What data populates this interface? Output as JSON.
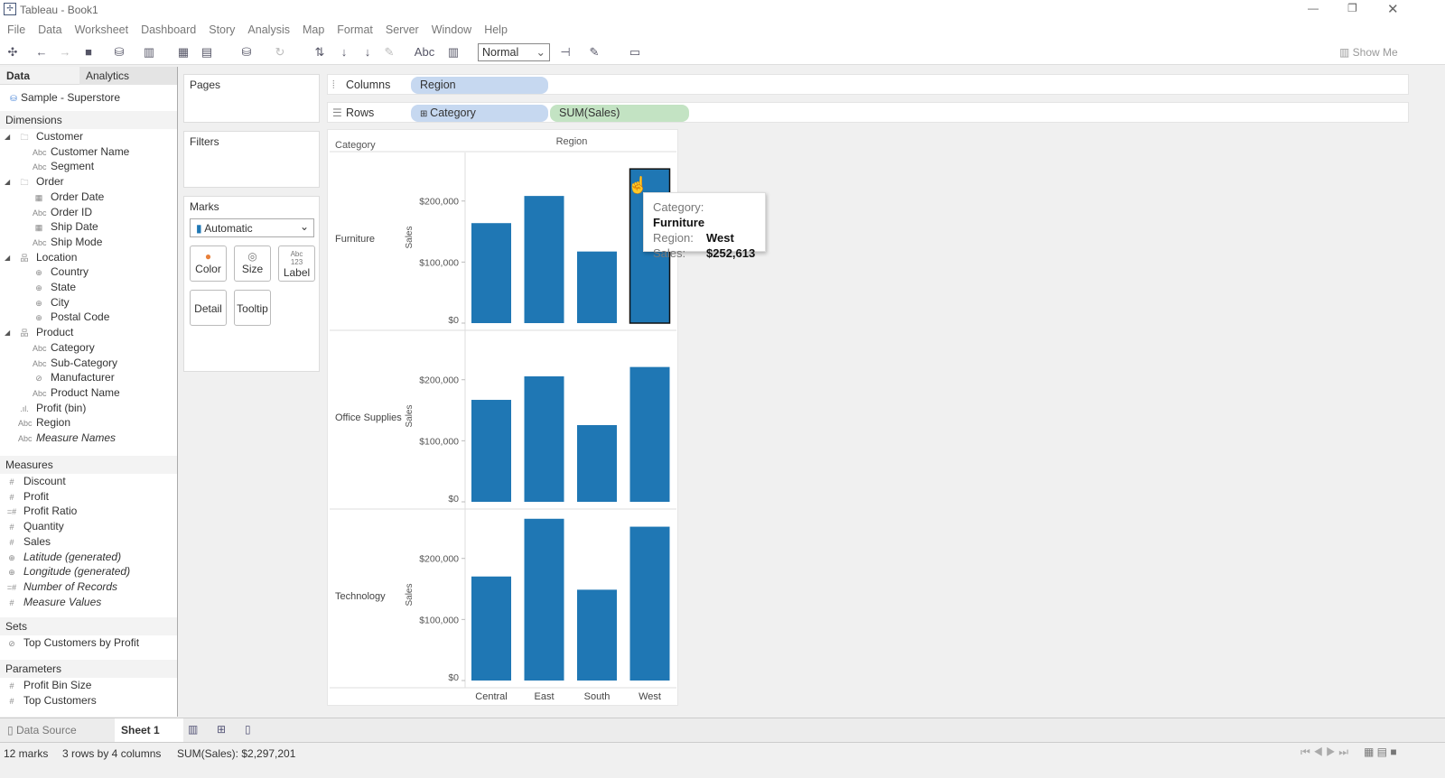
{
  "window": {
    "title": "Tableau - Book1"
  },
  "menu": [
    "File",
    "Data",
    "Worksheet",
    "Dashboard",
    "Story",
    "Analysis",
    "Map",
    "Format",
    "Server",
    "Window",
    "Help"
  ],
  "toolbar": {
    "fit": "Normal",
    "show_me": "Show Me"
  },
  "left": {
    "tab_data": "Data",
    "tab_analytics": "Analytics",
    "datasource": "Sample - Superstore",
    "dimensions_label": "Dimensions",
    "dimensions": [
      {
        "label": "Customer",
        "icon": "folder",
        "level": 0
      },
      {
        "label": "Customer Name",
        "icon": "Abc",
        "level": 1
      },
      {
        "label": "Segment",
        "icon": "Abc",
        "level": 1
      },
      {
        "label": "Order",
        "icon": "folder",
        "level": 0
      },
      {
        "label": "Order Date",
        "icon": "date",
        "level": 1
      },
      {
        "label": "Order ID",
        "icon": "Abc",
        "level": 1
      },
      {
        "label": "Ship Date",
        "icon": "date",
        "level": 1
      },
      {
        "label": "Ship Mode",
        "icon": "Abc",
        "level": 1
      },
      {
        "label": "Location",
        "icon": "hierarchy",
        "level": 0
      },
      {
        "label": "Country",
        "icon": "globe",
        "level": 1
      },
      {
        "label": "State",
        "icon": "globe",
        "level": 1
      },
      {
        "label": "City",
        "icon": "globe",
        "level": 1
      },
      {
        "label": "Postal Code",
        "icon": "globe",
        "level": 1
      },
      {
        "label": "Product",
        "icon": "hierarchy",
        "level": 0
      },
      {
        "label": "Category",
        "icon": "Abc",
        "level": 1
      },
      {
        "label": "Sub-Category",
        "icon": "Abc",
        "level": 1
      },
      {
        "label": "Manufacturer",
        "icon": "link",
        "level": 1
      },
      {
        "label": "Product Name",
        "icon": "Abc",
        "level": 1
      },
      {
        "label": "Profit (bin)",
        "icon": "bin",
        "level": 0
      },
      {
        "label": "Region",
        "icon": "Abc",
        "level": 0
      },
      {
        "label": "Measure Names",
        "icon": "Abc",
        "level": 0,
        "italic": true
      }
    ],
    "measures_label": "Measures",
    "measures": [
      {
        "label": "Discount",
        "icon": "#"
      },
      {
        "label": "Profit",
        "icon": "#"
      },
      {
        "label": "Profit Ratio",
        "icon": "=#"
      },
      {
        "label": "Quantity",
        "icon": "#"
      },
      {
        "label": "Sales",
        "icon": "#"
      },
      {
        "label": "Latitude (generated)",
        "icon": "globe",
        "italic": true
      },
      {
        "label": "Longitude (generated)",
        "icon": "globe",
        "italic": true
      },
      {
        "label": "Number of Records",
        "icon": "=#",
        "italic": true
      },
      {
        "label": "Measure Values",
        "icon": "#",
        "italic": true
      }
    ],
    "sets_label": "Sets",
    "sets": [
      {
        "label": "Top Customers by Profit"
      }
    ],
    "params_label": "Parameters",
    "params": [
      {
        "label": "Profit Bin Size"
      },
      {
        "label": "Top Customers"
      }
    ]
  },
  "cards": {
    "pages": "Pages",
    "filters": "Filters",
    "marks": "Marks",
    "mark_type": "Automatic",
    "buttons": [
      "Color",
      "Size",
      "Label",
      "Detail",
      "Tooltip"
    ]
  },
  "shelves": {
    "columns": "Columns",
    "rows": "Rows",
    "col_pill": "Region",
    "row_pill1": "Category",
    "row_pill2": "SUM(Sales)"
  },
  "chart_data": {
    "type": "bar",
    "title": "",
    "row_header": "Category",
    "col_header": "Region",
    "ylabel": "Sales",
    "categories": [
      "Central",
      "East",
      "South",
      "West"
    ],
    "yticks": [
      "$0",
      "$100,000",
      "$200,000"
    ],
    "ylim": [
      0,
      275000
    ],
    "series": [
      {
        "name": "Furniture",
        "values": [
          163797,
          208291,
          117299,
          252613
        ]
      },
      {
        "name": "Office Supplies",
        "values": [
          167026,
          205516,
          125651,
          220853
        ]
      },
      {
        "name": "Technology",
        "values": [
          170416,
          264974,
          148772,
          251992
        ]
      }
    ],
    "color": "#1f77b4",
    "highlighted": {
      "series": 0,
      "index": 3
    }
  },
  "tooltip": {
    "k1": "Category:",
    "v1": "Furniture",
    "k2": "Region:",
    "v2": "West",
    "k3": "Sales:",
    "v3": "$252,613"
  },
  "bottom": {
    "datasource": "Data Source",
    "sheet": "Sheet 1"
  },
  "status": {
    "marks": "12 marks",
    "dims": "3 rows by 4 columns",
    "sum": "SUM(Sales): $2,297,201"
  }
}
